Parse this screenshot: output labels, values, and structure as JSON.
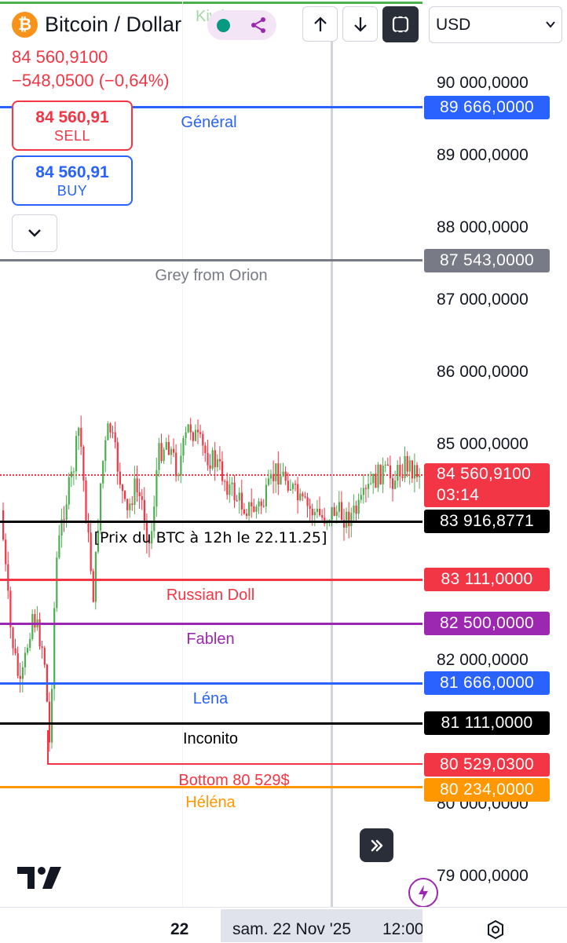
{
  "header": {
    "symbol_title": "Bitcoin / Dollar",
    "watermark": "Kiwi",
    "currency": "USD",
    "last_price": "84 560,9100",
    "change": "−548,0500 (−0,64%)"
  },
  "trade": {
    "sell_price": "84 560,91",
    "sell_label": "SELL",
    "buy_price": "84 560,91",
    "buy_label": "BUY"
  },
  "price_scale": {
    "ticks": [
      "90 000,0000",
      "89 000,0000",
      "88 000,0000",
      "87 000,0000",
      "86 000,0000",
      "85 000,0000",
      "82 000,0000",
      "79 000,0000",
      "80 000,0000"
    ]
  },
  "levels": [
    {
      "name": "level-general",
      "label": "Général",
      "price": "89 666,0000",
      "color": "#2962ff"
    },
    {
      "name": "level-grey-from-orion",
      "label": "Grey from Orion",
      "price": "87 543,0000",
      "color": "#787b86"
    },
    {
      "name": "level-prix-btc",
      "label": "[Prix du BTC à 12h le 22.11.25]",
      "price": "83 916,8771",
      "color": "#000000"
    },
    {
      "name": "level-russian-doll",
      "label": "Russian Doll",
      "price": "83 111,0000",
      "color": "#f23645"
    },
    {
      "name": "level-fablen",
      "label": "Fablen",
      "price": "82 500,0000",
      "color": "#9c27b0"
    },
    {
      "name": "level-lena",
      "label": "Léna",
      "price": "81 666,0000",
      "color": "#2962ff"
    },
    {
      "name": "level-inconito",
      "label": "Inconito",
      "price": "81 111,0000",
      "color": "#000000"
    },
    {
      "name": "level-bottom",
      "label": "Bottom 80 529$",
      "price": "80 529,0300",
      "color": "#f23645"
    },
    {
      "name": "level-helena",
      "label": "Héléna",
      "price": "80 234,0000",
      "color": "#ff9800"
    }
  ],
  "current_price": {
    "price": "84 560,9100",
    "countdown": "03:14",
    "color": "#f23645"
  },
  "time_axis": {
    "day_label": "22",
    "crosshair_label": "sam. 22 Nov '25",
    "time_label": "12:00"
  },
  "colors": {
    "up": "#089981",
    "up_green": "#4caf50",
    "down": "#f23645",
    "accent": "#2962ff"
  }
}
